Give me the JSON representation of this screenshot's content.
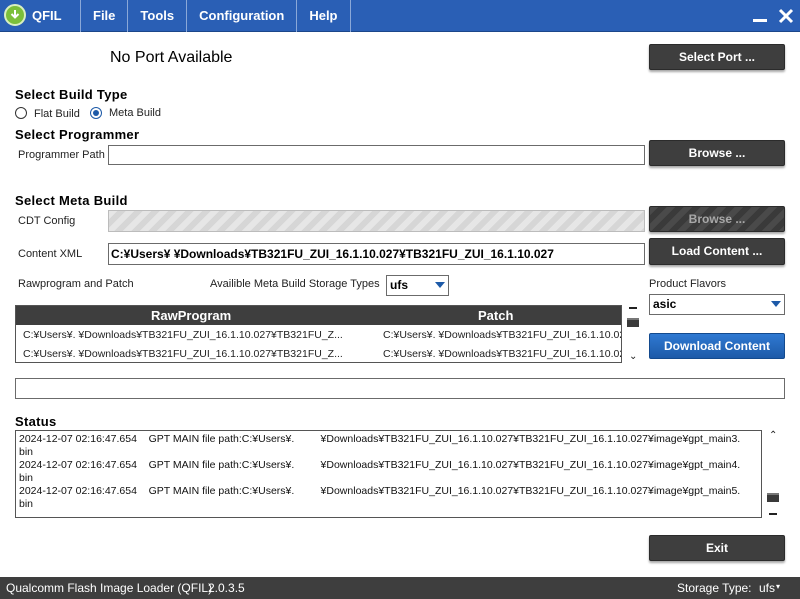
{
  "app": {
    "name": "QFIL",
    "logo_icon": "download-arrow-icon"
  },
  "menu": [
    {
      "label": "File"
    },
    {
      "label": "Tools"
    },
    {
      "label": "Configuration"
    },
    {
      "label": "Help"
    }
  ],
  "window_controls": {
    "minimize_icon": "minimize-icon",
    "close_icon": "close-icon"
  },
  "port": {
    "status": "No Port Available",
    "select_button": "Select Port ..."
  },
  "build_type": {
    "heading": "Select Build Type",
    "options": [
      {
        "label": "Flat Build",
        "selected": false
      },
      {
        "label": "Meta Build",
        "selected": true
      }
    ]
  },
  "programmer": {
    "heading": "Select Programmer",
    "path_label": "Programmer Path",
    "path_value": "",
    "browse_button": "Browse ..."
  },
  "meta_build": {
    "heading": "Select Meta Build",
    "cdt_label": "CDT Config",
    "cdt_value": "",
    "cdt_browse_button": "Browse ...",
    "content_xml_label": "Content XML",
    "content_xml_value": "C:¥Users¥         ¥Downloads¥TB321FU_ZUI_16.1.10.027¥TB321FU_ZUI_16.1.10.027",
    "load_content_button": "Load Content ...",
    "rawprogram_label": "Rawprogram and Patch",
    "storage_types_label": "Availible Meta Build Storage Types",
    "storage_type_value": "ufs",
    "product_flavors_label": "Product Flavors",
    "product_flavor_value": "asic",
    "download_button": "Download Content"
  },
  "table": {
    "columns": [
      "RawProgram",
      "Patch"
    ],
    "rows": [
      {
        "rawprogram": "C:¥Users¥.        ¥Downloads¥TB321FU_ZUI_16.1.10.027¥TB321FU_Z...",
        "patch": "C:¥Users¥.        ¥Downloads¥TB321FU_ZUI_16.1.10.027¥TB321FU_ZUI_1..."
      },
      {
        "rawprogram": "C:¥Users¥.        ¥Downloads¥TB321FU_ZUI_16.1.10.027¥TB321FU_Z...",
        "patch": "C:¥Users¥.        ¥Downloads¥TB321FU_ZUI_16.1.10.027¥TB321FU_ZUI_1..."
      }
    ]
  },
  "progress_value": "",
  "status": {
    "heading": "Status",
    "lines": [
      "2024-12-07 02:16:47.654    GPT MAIN file path:C:¥Users¥.         ¥Downloads¥TB321FU_ZUI_16.1.10.027¥TB321FU_ZUI_16.1.10.027¥image¥gpt_main3.",
      "bin",
      "2024-12-07 02:16:47.654    GPT MAIN file path:C:¥Users¥.         ¥Downloads¥TB321FU_ZUI_16.1.10.027¥TB321FU_ZUI_16.1.10.027¥image¥gpt_main4.",
      "bin",
      "2024-12-07 02:16:47.654    GPT MAIN file path:C:¥Users¥.         ¥Downloads¥TB321FU_ZUI_16.1.10.027¥TB321FU_ZUI_16.1.10.027¥image¥gpt_main5.",
      "bin"
    ]
  },
  "exit_button": "Exit",
  "footer": {
    "app_title": "Qualcomm Flash Image Loader (QFIL)",
    "version": "2.0.3.5",
    "storage_label": "Storage Type:",
    "storage_value": "ufs"
  },
  "colors": {
    "titlebar": "#2a5fb5",
    "dark_button": "#3e3e3e",
    "accent": "#1d5aa8"
  }
}
